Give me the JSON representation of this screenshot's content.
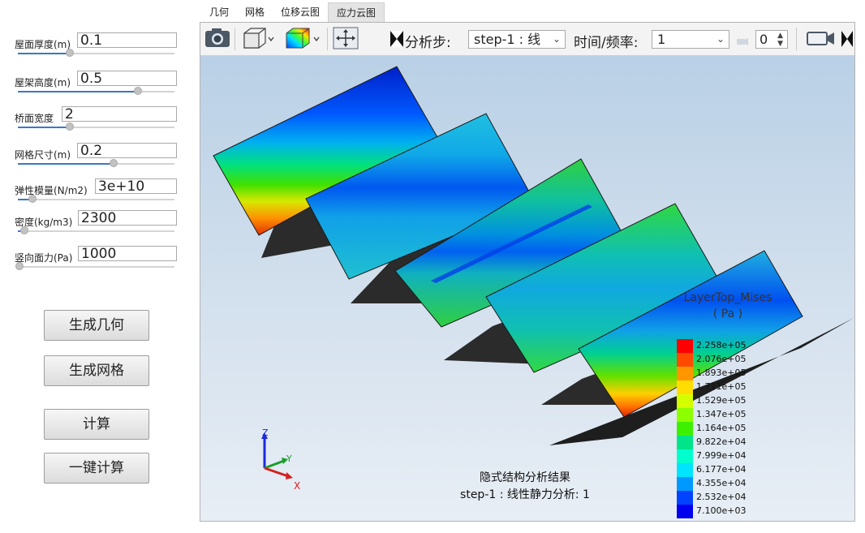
{
  "params": [
    {
      "label": "屋面厚度(m)",
      "value": "0.1",
      "slider": 0.32
    },
    {
      "label": "屋架高度(m)",
      "value": "0.5",
      "slider": 0.75
    },
    {
      "label": "桥面宽度",
      "value": "2",
      "slider": 0.32
    },
    {
      "label": "网格尺寸(m)",
      "value": "0.2",
      "slider": 0.62
    },
    {
      "label": "弹性模量(N/m2)",
      "value": "3e+10",
      "slider": 0.08
    },
    {
      "label": "密度(kg/m3)",
      "value": "2300",
      "slider": 0.02
    },
    {
      "label": "竖向面力(Pa)",
      "value": "1000",
      "slider": 0.0
    }
  ],
  "buttons": {
    "generate_geometry": "生成几何",
    "generate_mesh": "生成网格",
    "compute": "计算",
    "one_click_compute": "一键计算"
  },
  "tabs": [
    "几何",
    "网格",
    "位移云图",
    "应力云图"
  ],
  "active_tab": 3,
  "toolbar": {
    "step_label": "分析步:",
    "step_value": "step-1 : 线",
    "time_label": "时间/频率:",
    "time_value": "1",
    "frame_value": "0",
    "icons": [
      "camera-icon",
      "view-cube-icon",
      "color-map-icon",
      "fit-view-icon",
      "step-toggle-icon",
      "video-camera-icon"
    ]
  },
  "result": {
    "title": "隐式结构分析结果",
    "subtitle": "step-1 : 线性静力分析: 1"
  },
  "axes": {
    "x": "X",
    "y": "Y",
    "z": "Z"
  },
  "legend": {
    "title": "LayerTop_Mises",
    "unit": "( Pa )",
    "labels": [
      "2.258e+05",
      "2.076e+05",
      "1.893e+05",
      "1.711e+05",
      "1.529e+05",
      "1.347e+05",
      "1.164e+05",
      "9.822e+04",
      "7.999e+04",
      "6.177e+04",
      "4.355e+04",
      "2.532e+04",
      "7.100e+03"
    ],
    "colors": [
      "#ff0000",
      "#ff4a00",
      "#ff9600",
      "#ffdd00",
      "#d4ff00",
      "#8cff00",
      "#3cf000",
      "#00e58a",
      "#00ffcc",
      "#00e5ff",
      "#0099ff",
      "#0044ff",
      "#0000ee"
    ]
  }
}
